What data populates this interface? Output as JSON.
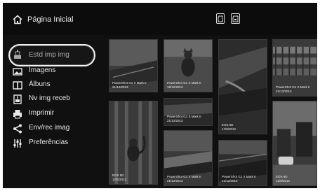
{
  "header": {
    "title": "Página Inicial",
    "icons": [
      "home-icon",
      "sd-card-icon",
      "sd-card-icon"
    ],
    "sd_labels": [
      "",
      ""
    ]
  },
  "menu": {
    "items": [
      {
        "label": "Estd imp img",
        "icon": "printer-status-icon",
        "selected": true
      },
      {
        "label": "Imagens",
        "icon": "images-icon",
        "selected": false
      },
      {
        "label": "Álbuns",
        "icon": "book-icon",
        "selected": false
      },
      {
        "label": "Nv img receb",
        "icon": "new-image-icon",
        "selected": false
      },
      {
        "label": "Imprimir",
        "icon": "printer-icon",
        "selected": false
      },
      {
        "label": "Env/rec imag",
        "icon": "share-icon",
        "selected": false
      },
      {
        "label": "Preferências",
        "icon": "preferences-icon",
        "selected": false
      }
    ]
  },
  "thumbnails": [
    {
      "camera": "PowerShot G1 X Mark II",
      "date": "21/12/2013"
    },
    {
      "camera": "PowerShot G1 X Mark II",
      "date": "19/12/2013"
    },
    {
      "camera": "EOS 6D",
      "date": "17/8/2012"
    },
    {
      "camera": "PowerShot G1 X Mark II",
      "date": "21/12/2013"
    },
    {
      "camera": "EOS 6D",
      "date": "12/8/2012"
    },
    {
      "camera": "PowerShot G1 X Mark II",
      "date": "21/12/2013"
    },
    {
      "camera": "PowerShot G1 X Mark II",
      "date": "21/12/2013"
    },
    {
      "camera": "EOS 6D",
      "date": "12/8/2012"
    }
  ],
  "colors": {
    "background": "#101010",
    "text": "#e8e8e8",
    "selection_ring": "#f2f2f2"
  }
}
